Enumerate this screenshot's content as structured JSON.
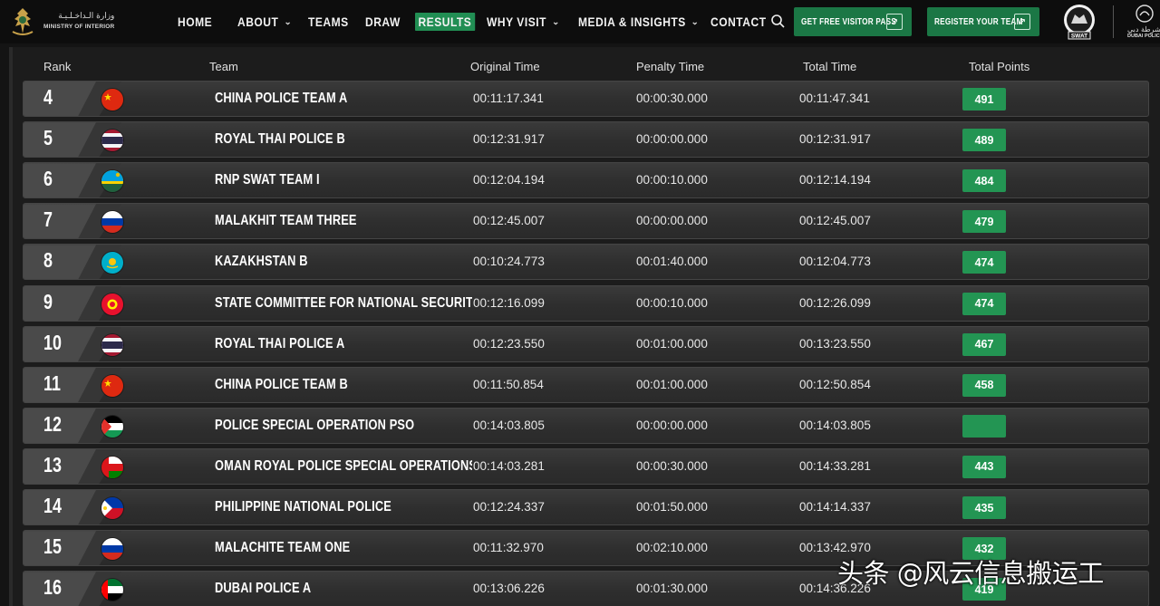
{
  "header": {
    "moi_ar": "وزارة الـداخـلـيـة",
    "moi_en": "MINISTRY OF INTERIOR",
    "nav": [
      {
        "label": "HOME",
        "active": false,
        "dropdown": false
      },
      {
        "label": "ABOUT",
        "active": false,
        "dropdown": true
      },
      {
        "label": "TEAMS",
        "active": false,
        "dropdown": false
      },
      {
        "label": "DRAW",
        "active": false,
        "dropdown": false
      },
      {
        "label": "RESULTS",
        "active": true,
        "dropdown": false
      },
      {
        "label": "WHY VISIT",
        "active": false,
        "dropdown": true
      },
      {
        "label": "MEDIA & INSIGHTS",
        "active": false,
        "dropdown": true
      },
      {
        "label": "CONTACT",
        "active": false,
        "dropdown": false
      }
    ],
    "cta_visitor": "GET FREE VISITOR PASS",
    "cta_register": "REGISTER YOUR TEAM",
    "swat_label": "SWAT",
    "dp_ar": "شرطة دبي",
    "dp_en": "DUBAI POLICE",
    "accent": "#218e53"
  },
  "table": {
    "columns": {
      "rank": "Rank",
      "team": "Team",
      "original": "Original Time",
      "penalty": "Penalty Time",
      "total": "Total Time",
      "points": "Total Points"
    },
    "rows": [
      {
        "rank": "4",
        "flag": "china",
        "team": "CHINA POLICE TEAM A",
        "original": "00:11:17.341",
        "penalty": "00:00:30.000",
        "total": "00:11:47.341",
        "points": "491"
      },
      {
        "rank": "5",
        "flag": "thailand",
        "team": "ROYAL THAI POLICE B",
        "original": "00:12:31.917",
        "penalty": "00:00:00.000",
        "total": "00:12:31.917",
        "points": "489"
      },
      {
        "rank": "6",
        "flag": "rwanda",
        "team": "RNP SWAT TEAM I",
        "original": "00:12:04.194",
        "penalty": "00:00:10.000",
        "total": "00:12:14.194",
        "points": "484"
      },
      {
        "rank": "7",
        "flag": "russia",
        "team": "MALAKHIT TEAM THREE",
        "original": "00:12:45.007",
        "penalty": "00:00:00.000",
        "total": "00:12:45.007",
        "points": "479"
      },
      {
        "rank": "8",
        "flag": "kazakhstan",
        "team": "KAZAKHSTAN B",
        "original": "00:10:24.773",
        "penalty": "00:01:40.000",
        "total": "00:12:04.773",
        "points": "474"
      },
      {
        "rank": "9",
        "flag": "kyrgyzstan",
        "team": "STATE COMMITTEE FOR NATIONAL SECURITY OF...",
        "original": "00:12:16.099",
        "penalty": "00:00:10.000",
        "total": "00:12:26.099",
        "points": "474"
      },
      {
        "rank": "10",
        "flag": "thailand",
        "team": "ROYAL THAI POLICE A",
        "original": "00:12:23.550",
        "penalty": "00:01:00.000",
        "total": "00:13:23.550",
        "points": "467"
      },
      {
        "rank": "11",
        "flag": "china",
        "team": "CHINA POLICE TEAM B",
        "original": "00:11:50.854",
        "penalty": "00:01:00.000",
        "total": "00:12:50.854",
        "points": "458"
      },
      {
        "rank": "12",
        "flag": "palestine",
        "team": "POLICE SPECIAL OPERATION PSO",
        "original": "00:14:03.805",
        "penalty": "00:00:00.000",
        "total": "00:14:03.805",
        "points": ""
      },
      {
        "rank": "13",
        "flag": "oman",
        "team": "OMAN ROYAL POLICE SPECIAL OPERATIONS TEA...",
        "original": "00:14:03.281",
        "penalty": "00:00:30.000",
        "total": "00:14:33.281",
        "points": "443"
      },
      {
        "rank": "14",
        "flag": "philippines",
        "team": "PHILIPPINE NATIONAL POLICE",
        "original": "00:12:24.337",
        "penalty": "00:01:50.000",
        "total": "00:14:14.337",
        "points": "435"
      },
      {
        "rank": "15",
        "flag": "russia",
        "team": "MALACHITE TEAM ONE",
        "original": "00:11:32.970",
        "penalty": "00:02:10.000",
        "total": "00:13:42.970",
        "points": "432"
      },
      {
        "rank": "16",
        "flag": "uae",
        "team": "DUBAI POLICE A",
        "original": "00:13:06.226",
        "penalty": "00:01:30.000",
        "total": "00:14:36.226",
        "points": "419"
      }
    ]
  },
  "watermark": "头条 @风云信息搬运工"
}
